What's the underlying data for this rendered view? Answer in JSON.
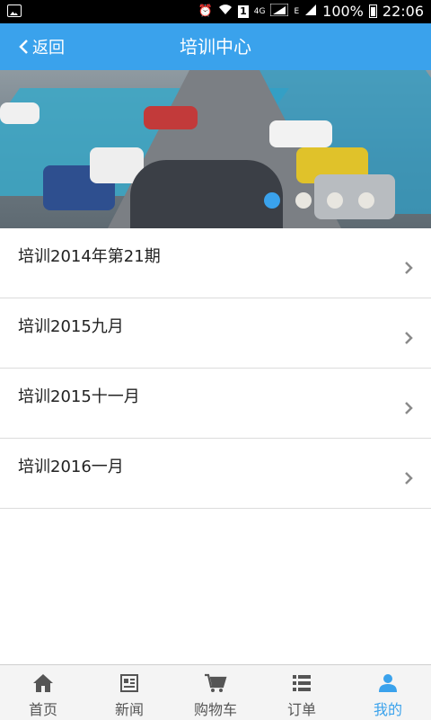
{
  "status_bar": {
    "network": "4G",
    "sim_label": "1",
    "signal_label": "E",
    "battery": "100%",
    "time": "22:06"
  },
  "header": {
    "back_label": "返回",
    "title": "培训中心",
    "background": "#3aa2ec"
  },
  "banner": {
    "image": "group-photo-cars-racetrack",
    "slides": 4,
    "active_slide": 1
  },
  "list": {
    "items": [
      {
        "label": "培训2014年第21期"
      },
      {
        "label": "培训2015九月"
      },
      {
        "label": "培训2015十一月"
      },
      {
        "label": "培训2016一月"
      }
    ]
  },
  "tabbar": {
    "active_color": "#3aa2ec",
    "tabs": [
      {
        "label": "首页",
        "icon": "home-icon"
      },
      {
        "label": "新闻",
        "icon": "news-icon"
      },
      {
        "label": "购物车",
        "icon": "cart-icon"
      },
      {
        "label": "订单",
        "icon": "list-icon"
      },
      {
        "label": "我的",
        "icon": "user-icon",
        "active": true
      }
    ]
  }
}
